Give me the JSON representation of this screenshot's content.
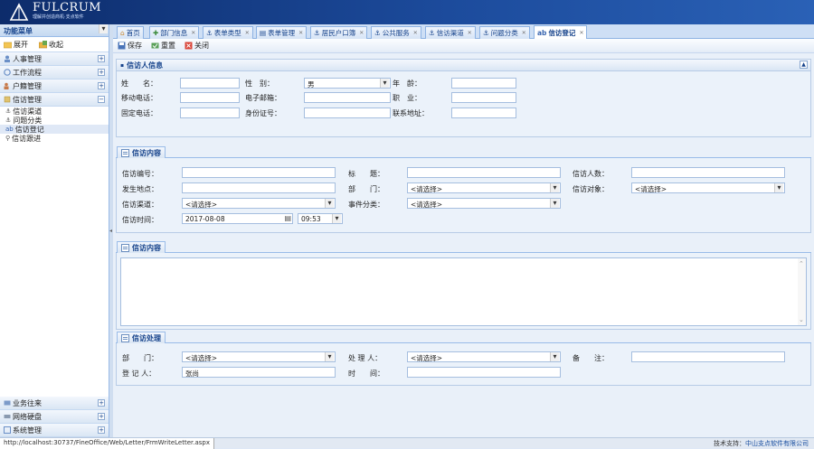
{
  "header": {
    "logo_text": "FULCRUM",
    "logo_sub": "理解并创造商机·支点软件"
  },
  "sidebar": {
    "title": "功能菜单",
    "tools": [
      "展开",
      "收起"
    ],
    "groups_top": [
      "人事管理",
      "工作流程",
      "户籍管理",
      "信访管理"
    ],
    "sub_items": [
      "信访渠道",
      "问题分类",
      "信访登记",
      "信访跟进"
    ],
    "groups_bottom": [
      "业务往来",
      "网络硬盘",
      "系统管理"
    ]
  },
  "tabs": [
    "首页",
    "部门信息",
    "表单类型",
    "表单管理",
    "居民户口簿",
    "公共服务",
    "信访渠道",
    "问题分类",
    "信访登记"
  ],
  "toolbar": {
    "save": "保存",
    "reset": "重置",
    "close": "关闭"
  },
  "section_visitor": {
    "title": "信访人信息",
    "name_label": "姓　　名：",
    "gender_label": "性　别：",
    "gender_value": "男",
    "age_label": "年　龄：",
    "mobile_label": "移动电话：",
    "email_label": "电子邮箱：",
    "job_label": "职　业：",
    "phone_label": "固定电话：",
    "id_label": "身份证号：",
    "address_label": "联系地址："
  },
  "section_content": {
    "title": "信访内容",
    "no_label": "信访编号：",
    "subject_label": "标　　题：",
    "count_label": "信访人数：",
    "place_label": "发生地点：",
    "dept_label": "部　　门：",
    "dept_value": "<请选择>",
    "target_label": "信访对象：",
    "target_value": "<请选择>",
    "channel_label": "信访渠道：",
    "channel_value": "<请选择>",
    "category_label": "事件分类：",
    "category_value": "<请选择>",
    "time_label": "信访时间：",
    "date_value": "2017-08-08",
    "clock_value": "09:53"
  },
  "section_text": {
    "title": "信访内容"
  },
  "section_handle": {
    "title": "信访处理",
    "dept_label": "部　　门：",
    "dept_value": "<请选择>",
    "handler_label": "处 理 人：",
    "handler_value": "<请选择>",
    "note_label": "备　　注：",
    "reg_label": "登 记 人：",
    "reg_value": "张尚",
    "time_label": "时　　间："
  },
  "status": {
    "url": "http://localhost:30737/FineOffice/Web/Letter/FrmWriteLetter.aspx",
    "support_label": "技术支持：",
    "support_link": "中山支点软件有限公司"
  }
}
